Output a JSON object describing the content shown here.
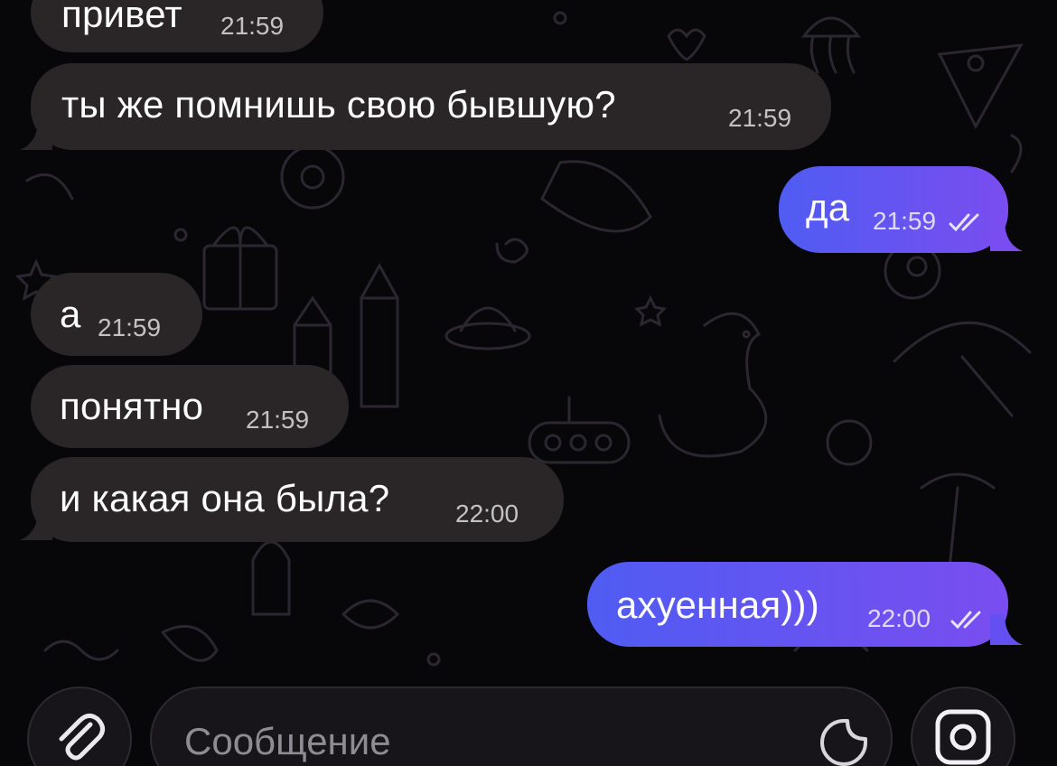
{
  "messages": [
    {
      "direction": "incoming",
      "text": "привет",
      "time": "21:59"
    },
    {
      "direction": "incoming",
      "text": "ты же помнишь свою бывшую?",
      "time": "21:59"
    },
    {
      "direction": "outgoing",
      "text": "да",
      "time": "21:59",
      "read_status": "double-check-icon"
    },
    {
      "direction": "incoming",
      "text": "а",
      "time": "21:59"
    },
    {
      "direction": "incoming",
      "text": "понятно",
      "time": "21:59"
    },
    {
      "direction": "incoming",
      "text": "и какая она была?",
      "time": "22:00"
    },
    {
      "direction": "outgoing",
      "text": "ахуенная)))",
      "time": "22:00",
      "read_status": "double-check-icon"
    }
  ],
  "composer": {
    "placeholder": "Сообщение",
    "attach_icon": "paperclip-icon",
    "sticker_icon": "sticker-icon",
    "camera_icon": "camera-icon"
  },
  "colors": {
    "incoming_bubble": "#2a2527",
    "outgoing_bubble_start": "#4f5cf2",
    "outgoing_bubble_end": "#7a4df0",
    "background": "#070609"
  }
}
